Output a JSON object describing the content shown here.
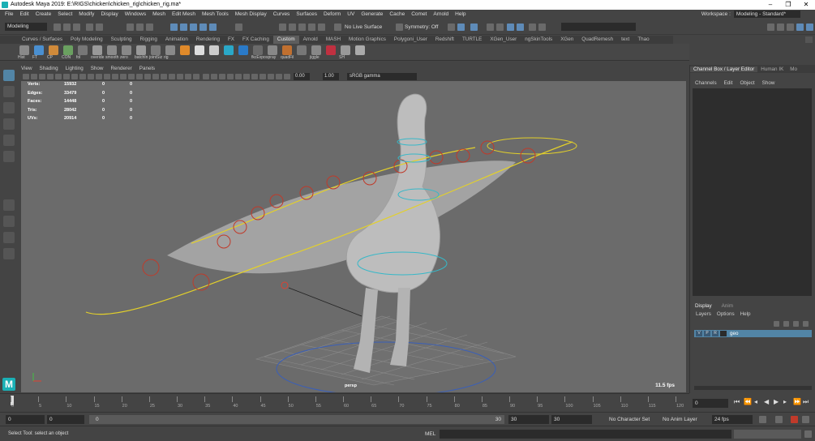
{
  "title_bar": {
    "title": "Autodesk Maya 2019: E:\\RIGS\\chicken\\chicken_rig\\chicken_rig.ma*",
    "minimize": "–",
    "restore": "❐",
    "close": "✕"
  },
  "menubar": {
    "items": [
      "File",
      "Edit",
      "Create",
      "Select",
      "Modify",
      "Display",
      "Windows",
      "Mesh",
      "Edit Mesh",
      "Mesh Tools",
      "Mesh Display",
      "Curves",
      "Surfaces",
      "Deform",
      "UV",
      "Generate",
      "Cache",
      "Comet",
      "Arnold",
      "Help"
    ],
    "workspace_label": "Workspace :",
    "workspace_value": "Modeling - Standard*"
  },
  "status_line": {
    "mode": "Modeling",
    "live_surface": "No Live Surface",
    "symmetry": "Symmetry: Off"
  },
  "shelf": {
    "tabs": [
      "Curves / Surfaces",
      "Poly Modeling",
      "Sculpting",
      "Rigging",
      "Animation",
      "Rendering",
      "FX",
      "FX Caching",
      "Custom",
      "Arnold",
      "MASH",
      "Motion Graphics",
      "Polygoni_User",
      "Redshift",
      "TURTLE",
      "XGen_User",
      "ngSkinTools",
      "XGen",
      "QuadRemesh",
      "text",
      "Thao"
    ],
    "active_tab": "Custom",
    "buttons": [
      "Hist",
      "FT",
      "CP",
      "CON",
      "fol",
      "overide",
      "smooth",
      "zero",
      "batchIn",
      "jointSiz",
      "rig",
      "",
      "",
      "",
      "",
      "",
      "fkcExpo",
      "spray",
      "quadFil",
      "",
      "jiggle",
      "",
      "SH",
      ""
    ]
  },
  "panel_menu": {
    "items": [
      "View",
      "Shading",
      "Lighting",
      "Show",
      "Renderer",
      "Panels"
    ],
    "near_clip": "0.00",
    "far_clip": "1.00",
    "color_space": "sRGB gamma"
  },
  "hud": {
    "rows": [
      {
        "label": "Verts:",
        "a": "15932",
        "b": "0",
        "c": "0"
      },
      {
        "label": "Edges:",
        "a": "33479",
        "b": "0",
        "c": "0"
      },
      {
        "label": "Faces:",
        "a": "14448",
        "b": "0",
        "c": "0"
      },
      {
        "label": "Tris:",
        "a": "28042",
        "b": "0",
        "c": "0"
      },
      {
        "label": "UVs:",
        "a": "20914",
        "b": "0",
        "c": "0"
      }
    ],
    "camera": "persp",
    "fps": "11.5 fps"
  },
  "right_panel": {
    "tabs": [
      "Channel Box / Layer Editor",
      "Human IK",
      "Mo"
    ],
    "menu": [
      "Channels",
      "Edit",
      "Object",
      "Show"
    ],
    "display_tabs": [
      "Display",
      "Anim"
    ],
    "display_menu": [
      "Layers",
      "Options",
      "Help"
    ],
    "layer": {
      "v": "V",
      "p": "P",
      "r": "R",
      "name": "geo"
    }
  },
  "timeline": {
    "ticks": [
      "0",
      "5",
      "10",
      "15",
      "20",
      "25",
      "30",
      "35",
      "40",
      "45",
      "50",
      "55",
      "60",
      "65",
      "70",
      "75",
      "80",
      "85",
      "90",
      "95",
      "100",
      "105",
      "110",
      "115",
      "120"
    ],
    "current_frame": "0"
  },
  "range": {
    "start": "0",
    "start2": "0",
    "slider_start": "0",
    "slider_end": "30",
    "end": "30",
    "end2": "30",
    "character_set": "No Character Set",
    "anim_layer": "No Anim Layer",
    "fps": "24 fps"
  },
  "command_line": {
    "help": "Select Tool: select an object",
    "lang": "MEL"
  }
}
